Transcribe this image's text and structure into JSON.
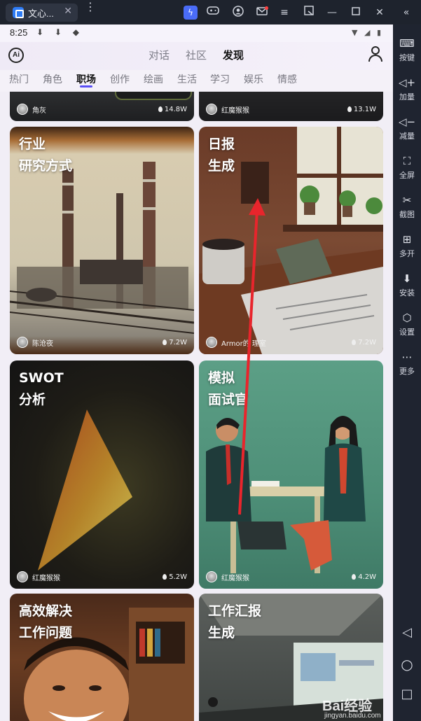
{
  "window": {
    "tab_title": "文心...",
    "close_glyph": "✕",
    "more_glyph": "⋮",
    "toolbar_icons": [
      "lightning-icon",
      "gamepad-icon",
      "account-icon",
      "mail-icon",
      "menu-icon",
      "popout-icon",
      "minimize-icon",
      "maximize-icon",
      "close-icon",
      "collapse-icon"
    ]
  },
  "statusbar": {
    "time": "8:25",
    "left_icons": "⬇ ⬇ ◆",
    "right_icons": "▼ ◢ ▮"
  },
  "header": {
    "logo": "Ai",
    "tabs": [
      {
        "label": "对话",
        "active": false
      },
      {
        "label": "社区",
        "active": false
      },
      {
        "label": "发现",
        "active": true
      }
    ]
  },
  "categories": [
    {
      "label": "热门",
      "active": false
    },
    {
      "label": "角色",
      "active": false
    },
    {
      "label": "职场",
      "active": true
    },
    {
      "label": "创作",
      "active": false
    },
    {
      "label": "绘画",
      "active": false
    },
    {
      "label": "生活",
      "active": false
    },
    {
      "label": "学习",
      "active": false
    },
    {
      "label": "娱乐",
      "active": false
    },
    {
      "label": "情感",
      "active": false
    }
  ],
  "cards": [
    {
      "title": "",
      "author": "角灰",
      "likes": "14.8W"
    },
    {
      "title": "",
      "author": "红魔猴猴",
      "likes": "13.1W"
    },
    {
      "title": "行业\n研究方式",
      "author": "陈沧夜",
      "likes": "7.2W"
    },
    {
      "title": "日报\n生成",
      "author": "Armor的   理室",
      "likes": "7.2W"
    },
    {
      "title": "SWOT\n分析",
      "author": "红魔猴猴",
      "likes": "5.2W"
    },
    {
      "title": "模拟\n面试官",
      "author": "红魔猴猴",
      "likes": "4.2W"
    },
    {
      "title": "高效解决\n工作问题",
      "author": "",
      "likes": ""
    },
    {
      "title": "工作汇报\n生成",
      "author": "",
      "likes": ""
    }
  ],
  "sidebar": [
    {
      "label": "按键",
      "icon": "keyboard-icon",
      "glyph": "⌨"
    },
    {
      "label": "加量",
      "icon": "volume-up-icon",
      "glyph": "◁+"
    },
    {
      "label": "减量",
      "icon": "volume-down-icon",
      "glyph": "◁−"
    },
    {
      "label": "全屏",
      "icon": "fullscreen-icon",
      "glyph": "⛶"
    },
    {
      "label": "截图",
      "icon": "scissors-icon",
      "glyph": "✂"
    },
    {
      "label": "多开",
      "icon": "multi-instance-icon",
      "glyph": "⊞"
    },
    {
      "label": "安装",
      "icon": "apk-install-icon",
      "glyph": "⬇"
    },
    {
      "label": "设置",
      "icon": "settings-icon",
      "glyph": "⬡"
    },
    {
      "label": "更多",
      "icon": "more-icon",
      "glyph": "⋯"
    }
  ],
  "nav": {
    "back": "◁",
    "home": "○",
    "recent": "□"
  },
  "watermark": {
    "brand": "Bai经验",
    "url": "jingyan.baidu.com"
  },
  "colors": {
    "accent": "#5a4ff5",
    "emulator_bg": "#1f2430",
    "annotation_arrow": "#e8252c"
  }
}
